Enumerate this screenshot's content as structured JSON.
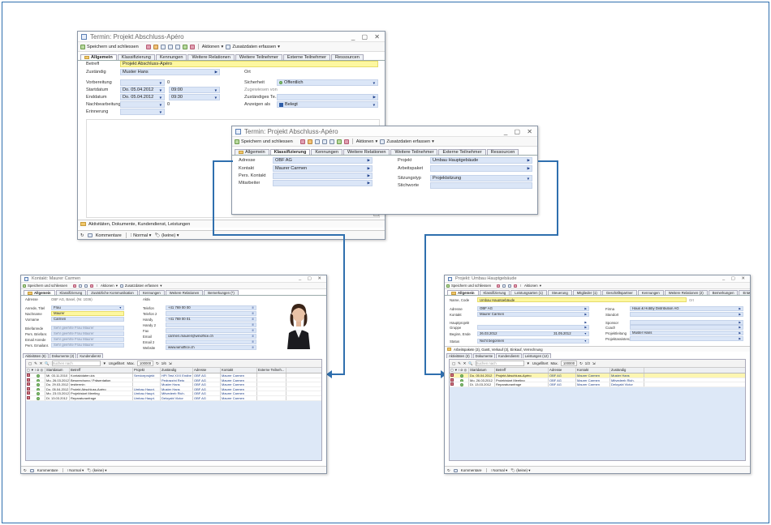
{
  "termin1": {
    "title": "Termin: Projekt Abschluss-Apéro",
    "window_controls": "_ ▢ ✕",
    "toolbar": {
      "save_close": "Speichern und schliessen",
      "actions": "Aktionen",
      "additional": "Zusatzdaten erfassen"
    },
    "tabs": [
      "Allgemein",
      "Klassifizierung",
      "Kennungen",
      "Weitere Relationen",
      "Weitere Teilnehmer",
      "Externe Teilnehmer",
      "Ressourcen"
    ],
    "fields": {
      "betreff_label": "Betreff",
      "betreff_value": "Projekt Abschluss-Apéro",
      "zustaendig_label": "Zuständig",
      "zustaendig_value": "Muster Hans",
      "ort_label": "Ort",
      "vorbereitung_label": "Vorbereitung",
      "vorbereitung_value": "0",
      "startdatum_label": "Startdatum",
      "startdatum_value": "Do. 05.04.2012",
      "start_time": "09:00",
      "enddatum_label": "Enddatum",
      "enddatum_value": "Do. 05.04.2012",
      "end_time": "09:30",
      "nachbearbeitung_label": "Nachbearbeitung",
      "nachbearbeitung_value": "0",
      "erinnerung_label": "Erinnerung",
      "sicherheit_label": "Sicherheit",
      "sicherheit_value": "Öffentlich",
      "zugewiesen_label": "Zugewiesen von",
      "zust_team_label": "Zuständiges Te...",
      "anzeigen_label": "Anzeigen als",
      "anzeigen_value": "Belegt"
    },
    "sub_bar": "Aktivitäten, Dokumente, Kundendienst, Leistungen",
    "footer": {
      "comments": "Kommentare",
      "priority": "Normal",
      "category": "(keine)"
    }
  },
  "termin2": {
    "title": "Termin: Projekt Abschluss-Apéro",
    "window_controls": "_ ▢ ✕",
    "toolbar": {
      "save_close": "Speichern und schliessen",
      "actions": "Aktionen",
      "additional": "Zusatzdaten erfassen"
    },
    "tabs": [
      "Allgemein",
      "Klassifizierung",
      "Kennungen",
      "Weitere Relationen",
      "Weitere Teilnehmer",
      "Externe Teilnehmer",
      "Ressourcen"
    ],
    "fields": {
      "adresse_label": "Adresse",
      "adresse_value": "OBF AG",
      "kontakt_label": "Kontakt",
      "kontakt_value": "Maurer Carmen",
      "pers_kontakt_label": "Pers. Kontakt",
      "mitarbeiter_label": "Mitarbeiter",
      "projekt_label": "Projekt",
      "projekt_value": "Umbau Hauptgebäude",
      "arbeitspaket_label": "Arbeitspaket",
      "sitzungstyp_label": "Sitzungstyp",
      "sitzungstyp_value": "Projektsitzung",
      "stichworte_label": "Stichworte"
    }
  },
  "kontakt": {
    "title": "Kontakt: Maurer Carmen",
    "window_controls": "_ ▢ ✕",
    "toolbar": {
      "save_close": "Speichern und schliessen",
      "actions": "Aktionen",
      "additional": "Zusatzdaten erfassen"
    },
    "tabs": [
      "Allgemein",
      "Klassifizierung",
      "Zusätzliche Kommunikation",
      "Kennungen",
      "Weitere Relationen",
      "Bemerkungen (*)"
    ],
    "left": [
      {
        "label": "Adresse",
        "value": "OBF AG, Basel, (Nr. 1036)"
      },
      {
        "label": "Anrede, Titel",
        "value": "Frau"
      },
      {
        "label": "Nachname",
        "value": "Maurer"
      },
      {
        "label": "Vorname",
        "value": "Carmen"
      },
      {
        "label": "Briefanrede",
        "value": "Sehr geehrte Frau Maurer"
      },
      {
        "label": "Pers. Briefanr.",
        "value": "Sehr geehrte Frau Maurer"
      },
      {
        "label": "Email Anrede",
        "value": "Sehr geehrte Frau Maurer"
      },
      {
        "label": "Pers. Emailanr.",
        "value": "Sehr geehrte Frau Maurer"
      }
    ],
    "right": [
      {
        "label": "Aktiv",
        "value": ""
      },
      {
        "label": "Telefon",
        "value": "+41 769 00 00"
      },
      {
        "label": "Telefon 2",
        "value": ""
      },
      {
        "label": "Handy",
        "value": "+41 769 00 01"
      },
      {
        "label": "Handy 2",
        "value": ""
      },
      {
        "label": "Fax",
        "value": ""
      },
      {
        "label": "Email",
        "value": "carmen.maurer@winoffice.ch"
      },
      {
        "label": "Email 2",
        "value": ""
      },
      {
        "label": "Website",
        "value": "www.winoffice.ch"
      }
    ],
    "subtabs": [
      "Aktivitäten (6)",
      "Dokumente (2)",
      "Kundendienst"
    ],
    "grid": {
      "search_placeholder": "Suchen nach",
      "filter": "Ungefiltert",
      "max_label": "Max.",
      "max_value": "100000",
      "count": "6",
      "headers": [
        "Startdatum",
        "Betreff",
        "Projekt",
        "Zuständig",
        "Adresse",
        "Kontakt",
        "Externe Teilneh..."
      ],
      "rows": [
        {
          "date": "Mi. 03.11.2010",
          "subject": "Kontaktdaten.kis",
          "project": "Serviceprojekt",
          "resp": "HPI Test XXX Endbe",
          "addr": "OBF AG",
          "contact": "Maurer Carmen",
          "ext": ""
        },
        {
          "date": "Mo. 26.03.2012",
          "subject": "Besprechung / Präsentation",
          "project": "",
          "resp": "Pedrazzini Reto",
          "addr": "OBF AG",
          "contact": "Maurer Carmen",
          "ext": ""
        },
        {
          "date": "Do. 29.03.2012",
          "subject": "testtermin",
          "project": "",
          "resp": "Muster Hans",
          "addr": "OBF AG",
          "contact": "Maurer Carmen",
          "ext": ""
        },
        {
          "date": "Do. 05.04.2012",
          "subject": "Projekt Abschluss-Apéro",
          "project": "Umbau Haupt.",
          "resp": "Muster Hans",
          "addr": "OBF AG",
          "contact": "Maurer Carmen",
          "ext": ""
        },
        {
          "date": "Mo. 23.03.2012",
          "subject": "Projektstart Meeting",
          "project": "Umbau Haupt.",
          "resp": "Mitvedeeb Rich.",
          "addr": "OBF AG",
          "contact": "Maurer Carmen",
          "ext": ""
        },
        {
          "date": "Di. 13.03.2012",
          "subject": "Reparaturanfrage",
          "project": "Umbau Haupt.",
          "resp": "Deloyabi Victor",
          "addr": "OBF AG",
          "contact": "Maurer Carmen",
          "ext": ""
        }
      ]
    },
    "footer": {
      "comments": "Kommentare",
      "priority": "Normal",
      "category": "(keine)"
    }
  },
  "projekt": {
    "title": "Projekt: Umbau Hauptgebäude",
    "window_controls": "_ ▢ ✕",
    "toolbar": {
      "save_close": "Speichern und schliessen",
      "actions": "Aktionen"
    },
    "tabs": [
      "Allgemein",
      "Klassifizierung",
      "Leistungsarten (1)",
      "Steuerung",
      "Mitglieder (1)",
      "Geschäftspartner",
      "Kennungen",
      "Weitere Relationen (2)",
      "Bemerkungen",
      "Entwicklung"
    ],
    "name_label": "Name, Code",
    "name_value": "Umbau Hauptgebäude",
    "code_value": "Ort",
    "left": [
      {
        "label": "Adresse",
        "value": "OBF AG"
      },
      {
        "label": "Kontakt",
        "value": "Maurer Carmen"
      },
      {
        "label": "Hauptprojekt",
        "value": ""
      },
      {
        "label": "Gruppe",
        "value": ""
      },
      {
        "label": "Beginn, Ende",
        "value": "26.03.2012",
        "value2": "31.05.2012"
      },
      {
        "label": "Status",
        "value": "Nicht begonnen"
      }
    ],
    "right": [
      {
        "label": "Firma",
        "value": "Haus & Hobby Distribution AG"
      },
      {
        "label": "Standort",
        "value": ""
      },
      {
        "label": "Sponsor",
        "value": ""
      },
      {
        "label": "Coach",
        "value": ""
      },
      {
        "label": "Projektleitung",
        "value": "Muster Hans"
      },
      {
        "label": "Projektassistenz",
        "value": ""
      }
    ],
    "sub_bar": "Arbeitspakete (3), Gantt, Verkauf (3), Einkauf, Verrechnung",
    "subtabs": [
      "Aktivitäten (3)",
      "Dokumente",
      "Kundendienst",
      "Leistungen (12)"
    ],
    "grid": {
      "search_placeholder": "Suchen nach",
      "filter": "Ungefiltert",
      "max_label": "Max.",
      "max_value": "100000",
      "count": "3",
      "headers": [
        "Startdatum",
        "Betreff",
        "Adresse",
        "Kontakt",
        "Zuständig"
      ],
      "rows": [
        {
          "date": "Do. 05.04.2012",
          "subject": "Projekt Abschluss-Apéro",
          "addr": "OBF AG",
          "contact": "Maurer Carmen",
          "resp": "Muster Hans"
        },
        {
          "date": "Mo. 26.03.2012",
          "subject": "Projektstart Meeting",
          "addr": "OBF AG",
          "contact": "Maurer Carmen",
          "resp": "Mitvedeeb Rich."
        },
        {
          "date": "Di. 13.03.2012",
          "subject": "Reparaturanfrage",
          "addr": "OBF AG",
          "contact": "Maurer Carmen",
          "resp": "Deloyabi Victor"
        }
      ]
    },
    "footer": {
      "comments": "Kommentare",
      "priority": "Normal",
      "category": "(keine)"
    }
  },
  "colors": {
    "accent": "#2f6fae",
    "field": "#dbe6f7",
    "highlight": "#fdf7a0"
  }
}
